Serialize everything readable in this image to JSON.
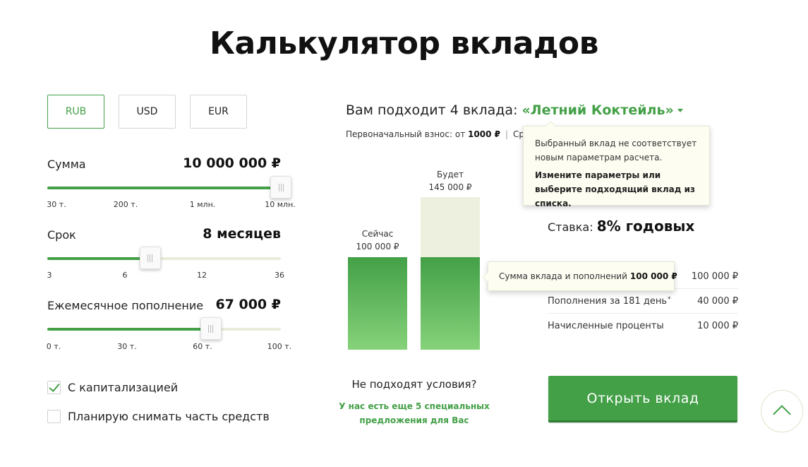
{
  "title": "Калькулятор вкладов",
  "currencies": [
    {
      "label": "RUB",
      "active": true
    },
    {
      "label": "USD",
      "active": false
    },
    {
      "label": "EUR",
      "active": false
    }
  ],
  "params": {
    "amount": {
      "label": "Сумма",
      "value": "10 000 000 ₽",
      "ticks": [
        "30 т.",
        "200 т.",
        "1 млн.",
        "10 млн."
      ],
      "level": 1.0
    },
    "term": {
      "label": "Срок",
      "value": "8 месяцев",
      "ticks": [
        "3",
        "6",
        "12",
        "36"
      ],
      "level": 0.44
    },
    "monthly": {
      "label": "Ежемесячное пополнение",
      "value": "67 000 ₽",
      "ticks": [
        "0 т.",
        "30 т.",
        "60 т.",
        "100 т."
      ],
      "level": 0.7
    }
  },
  "options": {
    "capitalization": {
      "label": "С капитализацией",
      "checked": true
    },
    "withdraw": {
      "label": "Планирую снимать часть средств",
      "checked": false
    }
  },
  "result": {
    "fit_prefix": "Вам подходит 4 вклада:",
    "deposit_name": "«Летний Коктейль»",
    "initial_prefix": "Первоначальный взнос: от",
    "initial_amount": "1000 ₽",
    "initial_suffix": "Ср",
    "rate_label": "Ставка:",
    "rate_value": "8% годовых"
  },
  "chart": {
    "now_label": "Сейчас",
    "now_value": "100 000 ₽",
    "future_label": "Будет",
    "future_value": "145 000 ₽"
  },
  "tooltips": {
    "mismatch_line1": "Выбранный вклад не соответствует новым параметрам расчета.",
    "mismatch_line2": "Измените параметры или выберите подходящий вклад из списка.",
    "sum_label": "Сумма вклада и пополнений",
    "sum_value": "100 000 ₽"
  },
  "table": [
    {
      "label": "",
      "value": "100 000 ₽"
    },
    {
      "label": "Пополнения за 181 день",
      "value": "40 000 ₽"
    },
    {
      "label": "Начисленные проценты",
      "value": "10 000 ₽"
    }
  ],
  "bottom": {
    "no_fit": "Не подходят условия?",
    "special": "У нас есть еще 5 специальных предложения для Вас",
    "open_button": "Открыть вклад"
  },
  "icons": {
    "check": "check-icon",
    "caret": "caret-down-icon",
    "scroll_top": "chevron-up-icon",
    "grip": "grip-icon"
  },
  "colors": {
    "accent": "#43a047",
    "accent_dark": "#2e7d32",
    "track": "#e9ecd9",
    "tooltip_bg": "#fdfdf2"
  }
}
